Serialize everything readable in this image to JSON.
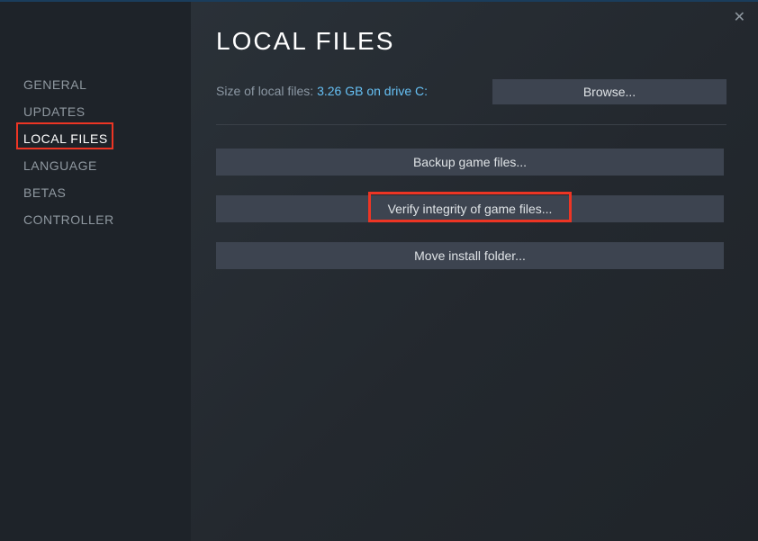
{
  "sidebar": {
    "items": [
      {
        "label": "GENERAL"
      },
      {
        "label": "UPDATES"
      },
      {
        "label": "LOCAL FILES"
      },
      {
        "label": "LANGUAGE"
      },
      {
        "label": "BETAS"
      },
      {
        "label": "CONTROLLER"
      }
    ],
    "active_index": 2
  },
  "header": {
    "title": "LOCAL FILES"
  },
  "local_files": {
    "size_label": "Size of local files: ",
    "size_value": "3.26 GB on drive C:",
    "browse_label": "Browse..."
  },
  "actions": {
    "backup_label": "Backup game files...",
    "verify_label": "Verify integrity of game files...",
    "move_label": "Move install folder..."
  },
  "icons": {
    "close": "✕"
  }
}
